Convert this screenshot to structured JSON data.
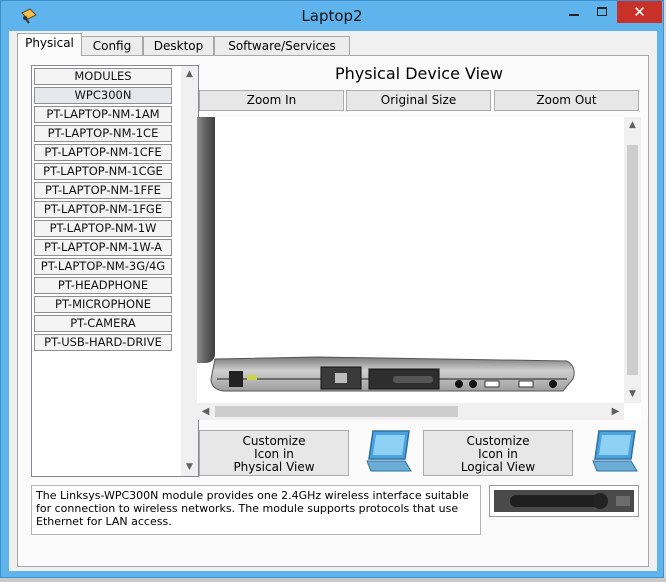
{
  "window": {
    "title": "Laptop2",
    "close_glyph": "✕"
  },
  "tabs": [
    {
      "label": "Physical",
      "active": true
    },
    {
      "label": "Config",
      "active": false
    },
    {
      "label": "Desktop",
      "active": false
    },
    {
      "label": "Software/Services",
      "active": false
    }
  ],
  "modules": {
    "items": [
      "MODULES",
      "WPC300N",
      "PT-LAPTOP-NM-1AM",
      "PT-LAPTOP-NM-1CE",
      "PT-LAPTOP-NM-1CFE",
      "PT-LAPTOP-NM-1CGE",
      "PT-LAPTOP-NM-1FFE",
      "PT-LAPTOP-NM-1FGE",
      "PT-LAPTOP-NM-1W",
      "PT-LAPTOP-NM-1W-A",
      "PT-LAPTOP-NM-3G/4G",
      "PT-HEADPHONE",
      "PT-MICROPHONE",
      "PT-CAMERA",
      "PT-USB-HARD-DRIVE"
    ]
  },
  "view": {
    "title": "Physical Device View",
    "zoom_in": "Zoom In",
    "original_size": "Original Size",
    "zoom_out": "Zoom Out"
  },
  "customize": {
    "physical": [
      "Customize",
      "Icon in",
      "Physical View"
    ],
    "logical": [
      "Customize",
      "Icon in",
      "Logical View"
    ]
  },
  "description": "The Linksys-WPC300N module provides one 2.4GHz wireless interface suitable for connection to wireless networks. The module supports protocols that use Ethernet for LAN access.",
  "icons": {
    "app": "packet-tracer-icon",
    "minimize": "minimize-icon",
    "maximize": "maximize-icon",
    "close": "close-icon",
    "laptop": "laptop-icon"
  },
  "colors": {
    "titlebar": "#5fb4ee",
    "close": "#c7312a",
    "laptop_screen": "#4aa3df"
  }
}
